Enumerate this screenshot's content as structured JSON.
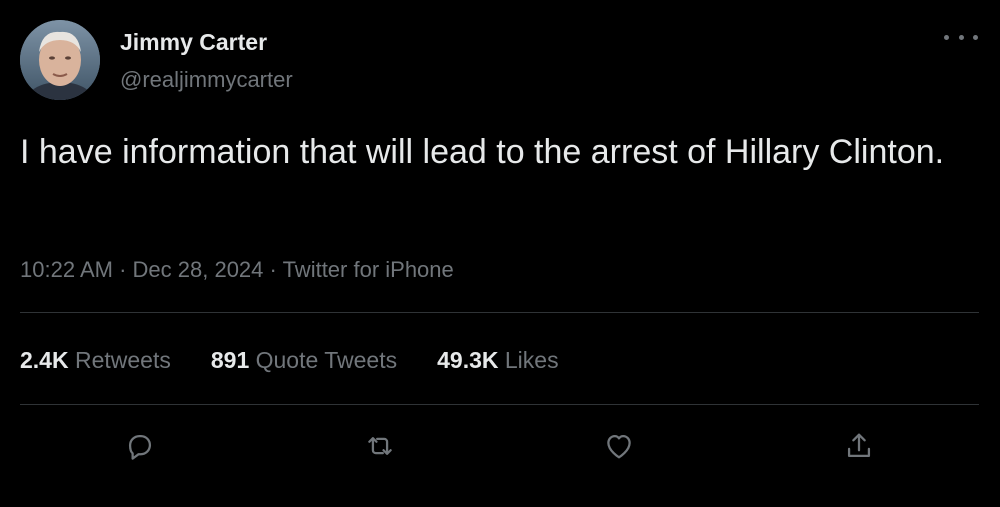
{
  "author": {
    "display_name": "Jimmy Carter",
    "handle": "@realjimmycarter",
    "avatar_icon": "user-avatar-photo"
  },
  "menu_icon": "more-options-icon",
  "tweet": {
    "text": "I have information that will lead to the arrest of Hillary Clinton.",
    "time": "10:22 AM",
    "date": "Dec 28, 2024",
    "source": "Twitter for iPhone",
    "separator": "·"
  },
  "stats": [
    {
      "count": "2.4K",
      "label": "Retweets"
    },
    {
      "count": "891",
      "label": "Quote Tweets"
    },
    {
      "count": "49.3K",
      "label": "Likes"
    }
  ],
  "actions": [
    {
      "icon": "reply-icon"
    },
    {
      "icon": "retweet-icon"
    },
    {
      "icon": "like-icon"
    },
    {
      "icon": "share-icon"
    }
  ],
  "colors": {
    "background": "#000000",
    "primary_text": "#e7e9ea",
    "secondary_text": "#71767b",
    "divider": "#2f3336"
  }
}
